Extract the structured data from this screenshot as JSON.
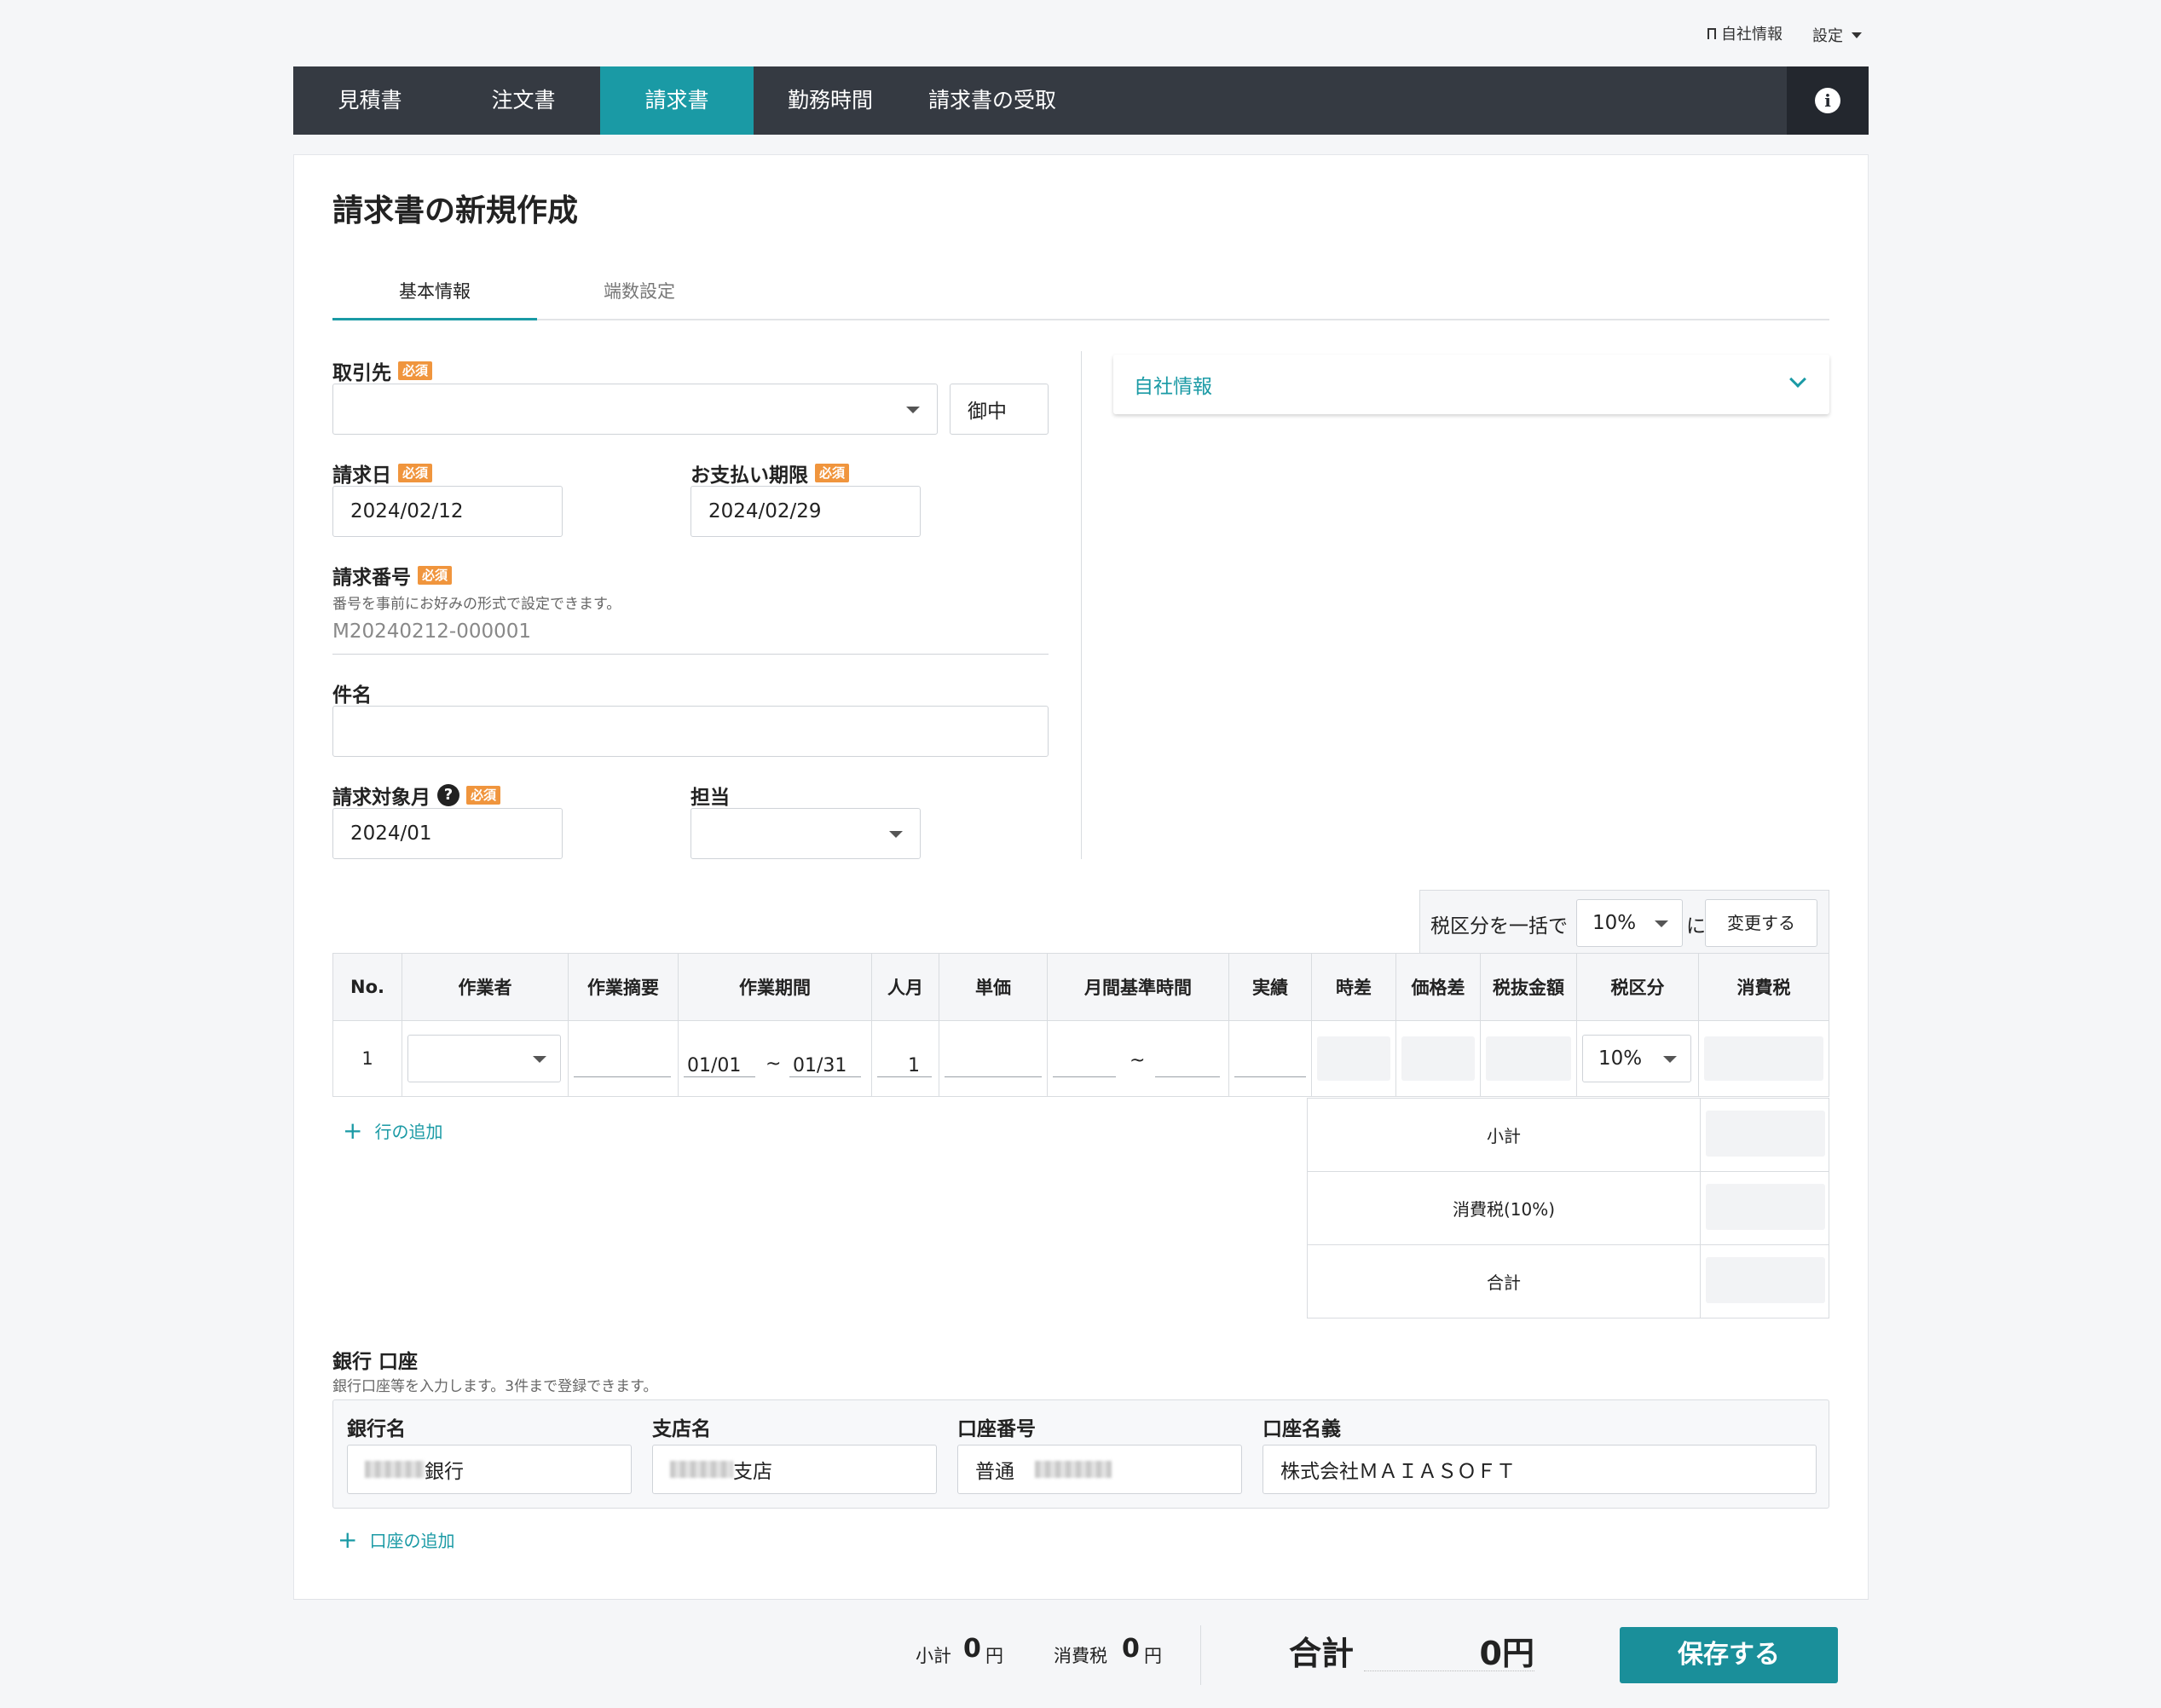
{
  "utility": {
    "company_info": "自社情報",
    "settings": "設定"
  },
  "nav": {
    "items": [
      {
        "label": "見積書"
      },
      {
        "label": "注文書"
      },
      {
        "label": "請求書"
      },
      {
        "label": "勤務時間"
      },
      {
        "label": "請求書の受取"
      }
    ],
    "active_index": 2
  },
  "page": {
    "title": "請求書の新規作成",
    "tabs": [
      {
        "label": "基本情報"
      },
      {
        "label": "端数設定"
      }
    ]
  },
  "form": {
    "required_badge": "必須",
    "client": {
      "label": "取引先",
      "value": "",
      "honorific": "御中"
    },
    "invoice_date": {
      "label": "請求日",
      "value": "2024/02/12"
    },
    "due_date": {
      "label": "お支払い期限",
      "value": "2024/02/29"
    },
    "invoice_number": {
      "label": "請求番号",
      "help": "番号を事前にお好みの形式で設定できます。",
      "value": "M20240212-000001"
    },
    "subject": {
      "label": "件名",
      "value": ""
    },
    "target_month": {
      "label": "請求対象月",
      "value": "2024/01"
    },
    "person_in_charge": {
      "label": "担当",
      "value": ""
    }
  },
  "company_panel": {
    "label": "自社情報"
  },
  "tax_bulk": {
    "prefix": "税区分を一括で",
    "value": "10%",
    "suffix": "に",
    "button": "変更する"
  },
  "table": {
    "headers": [
      "No.",
      "作業者",
      "作業摘要",
      "作業期間",
      "人月",
      "単価",
      "月間基準時間",
      "実績",
      "時差",
      "価格差",
      "税抜金額",
      "税区分",
      "消費税"
    ],
    "row": {
      "no": "1",
      "period_from": "01/01",
      "tilde": "~",
      "period_to": "01/31",
      "man_month": "1",
      "tax_class": "10%"
    }
  },
  "add_row": "行の追加",
  "summary": {
    "subtotal": "小計",
    "tax": "消費税(10%)",
    "total": "合計"
  },
  "bank": {
    "title": "銀行 口座",
    "help": "銀行口座等を入力します。3件まで登録できます。",
    "columns": [
      "銀行名",
      "支店名",
      "口座番号",
      "口座名義"
    ],
    "bank_name_suffix": "銀行",
    "branch_suffix": "支店",
    "account_type": "普通",
    "account_holder": "株式会社ＭＡＩＡＳＯＦＴ",
    "add_label": "口座の追加"
  },
  "footer": {
    "subtotal_label": "小計",
    "subtotal_value": "0",
    "yen": "円",
    "tax_label": "消費税",
    "tax_value": "0",
    "total_label": "合計",
    "total_value": "0円",
    "save": "保存する"
  }
}
